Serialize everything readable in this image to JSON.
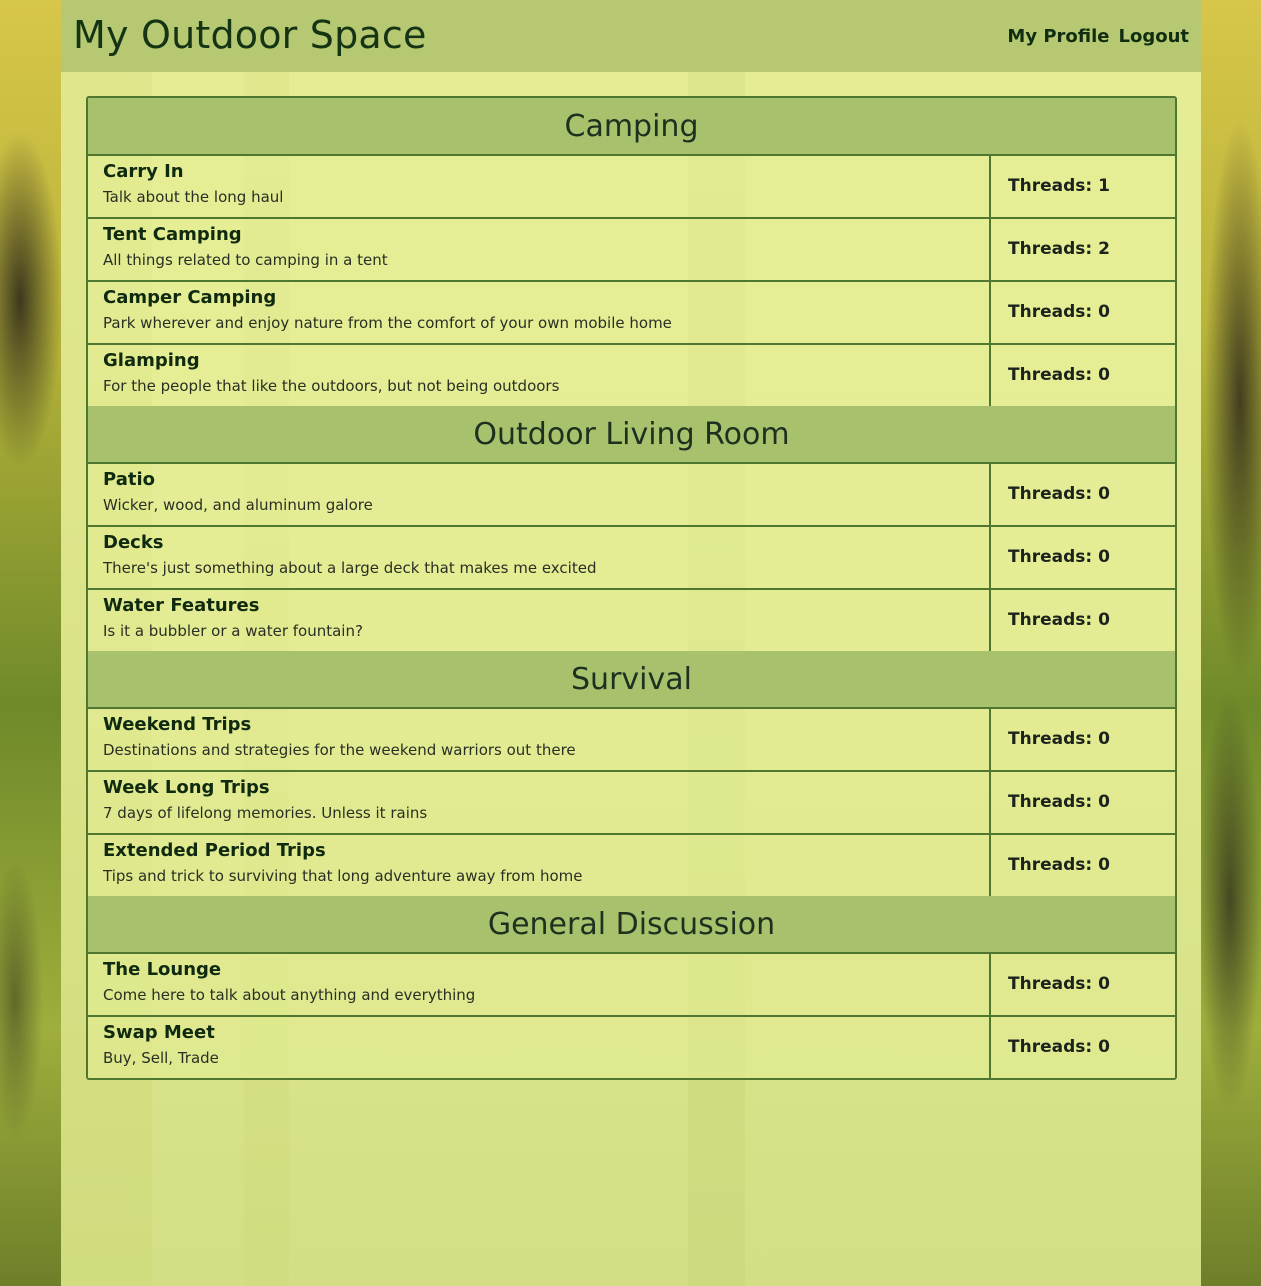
{
  "header": {
    "site_title": "My Outdoor Space",
    "nav": {
      "profile_label": "My Profile",
      "logout_label": "Logout"
    }
  },
  "categories": [
    {
      "name": "Camping",
      "forums": [
        {
          "title": "Carry In",
          "description": "Talk about the long haul",
          "threads": "Threads: 1"
        },
        {
          "title": "Tent Camping",
          "description": "All things related to camping in a tent",
          "threads": "Threads: 2"
        },
        {
          "title": "Camper Camping",
          "description": "Park wherever and enjoy nature from the comfort of your own mobile home",
          "threads": "Threads: 0"
        },
        {
          "title": "Glamping",
          "description": "For the people that like the outdoors, but not being outdoors",
          "threads": "Threads: 0"
        }
      ]
    },
    {
      "name": "Outdoor Living Room",
      "forums": [
        {
          "title": "Patio",
          "description": "Wicker, wood, and aluminum galore",
          "threads": "Threads: 0"
        },
        {
          "title": "Decks",
          "description": "There's just something about a large deck that makes me excited",
          "threads": "Threads: 0"
        },
        {
          "title": "Water Features",
          "description": "Is it a bubbler or a water fountain?",
          "threads": "Threads: 0"
        }
      ]
    },
    {
      "name": "Survival",
      "forums": [
        {
          "title": "Weekend Trips",
          "description": "Destinations and strategies for the weekend warriors out there",
          "threads": "Threads: 0"
        },
        {
          "title": "Week Long Trips",
          "description": "7 days of lifelong memories. Unless it rains",
          "threads": "Threads: 0"
        },
        {
          "title": "Extended Period Trips",
          "description": "Tips and trick to surviving that long adventure away from home",
          "threads": "Threads: 0"
        }
      ]
    },
    {
      "name": "General Discussion",
      "forums": [
        {
          "title": "The Lounge",
          "description": "Come here to talk about anything and everything",
          "threads": "Threads: 0"
        },
        {
          "title": "Swap Meet",
          "description": "Buy, Sell, Trade",
          "threads": "Threads: 0"
        }
      ]
    }
  ]
}
